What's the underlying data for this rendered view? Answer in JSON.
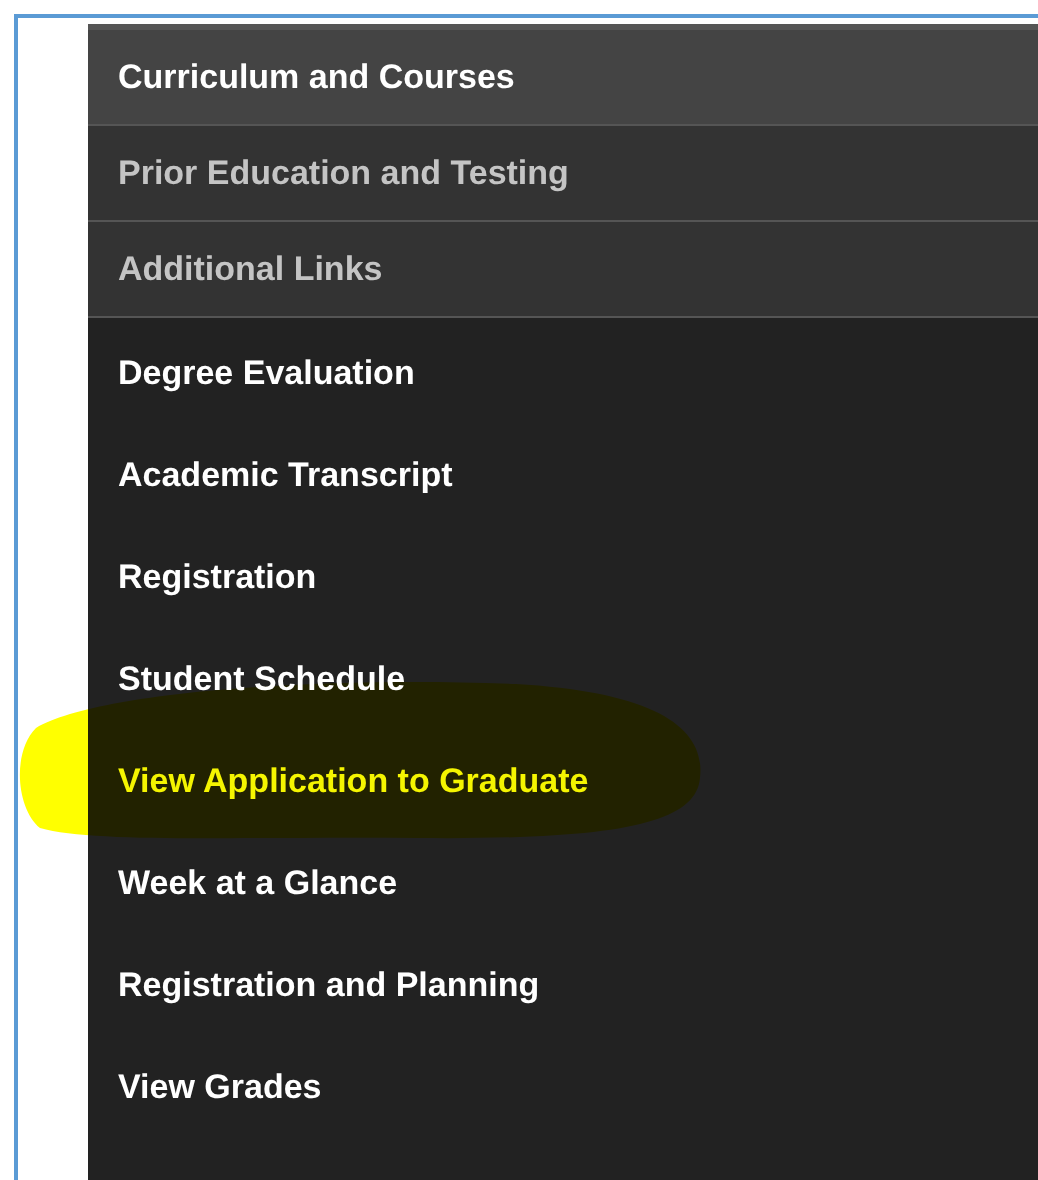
{
  "sections": [
    {
      "label": "Curriculum and Courses",
      "selected": true
    },
    {
      "label": "Prior Education and Testing",
      "selected": false
    },
    {
      "label": "Additional Links",
      "selected": false
    }
  ],
  "links": [
    {
      "label": "Degree Evaluation",
      "highlighted": false
    },
    {
      "label": "Academic Transcript",
      "highlighted": false
    },
    {
      "label": "Registration",
      "highlighted": false
    },
    {
      "label": "Student Schedule",
      "highlighted": false
    },
    {
      "label": "View Application to Graduate",
      "highlighted": true
    },
    {
      "label": "Week at a Glance",
      "highlighted": false
    },
    {
      "label": "Registration and Planning",
      "highlighted": false
    },
    {
      "label": "View Grades",
      "highlighted": false
    }
  ]
}
